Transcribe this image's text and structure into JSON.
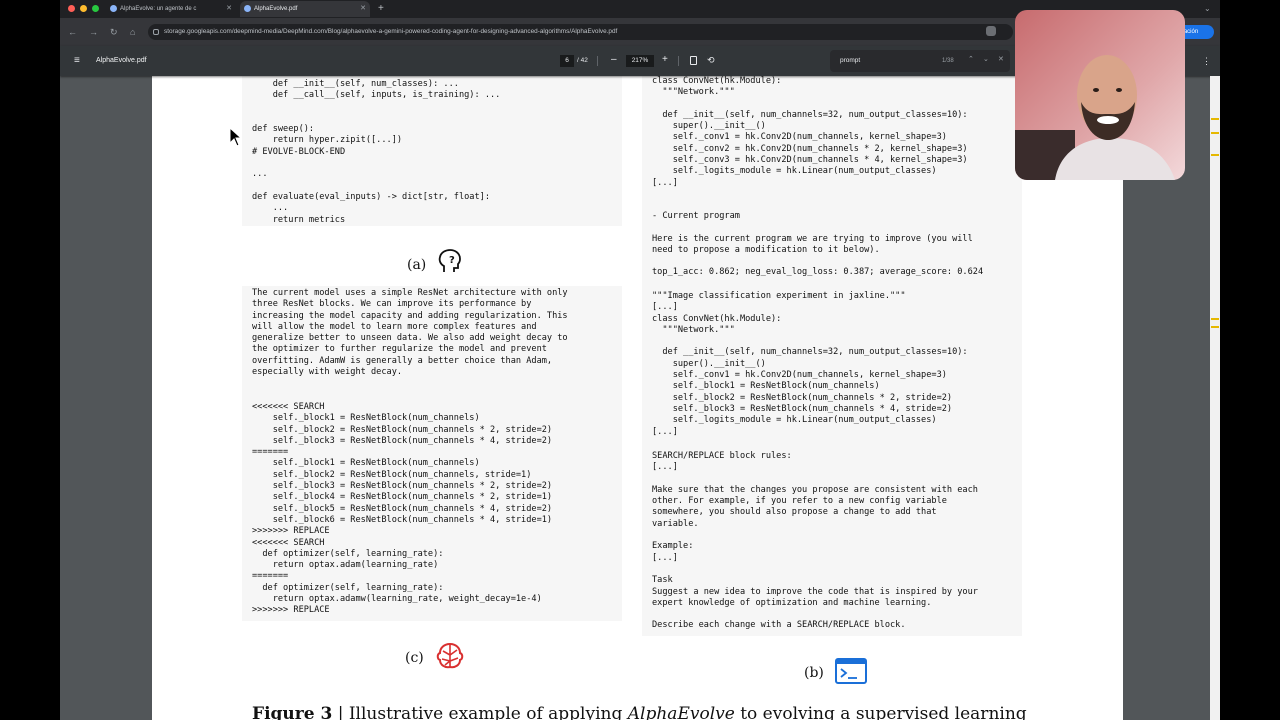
{
  "browser": {
    "tabs": [
      {
        "title": "AlphaEvolve: un agente de c"
      },
      {
        "title": "AlphaEvolve.pdf"
      }
    ],
    "url": "storage.googleapis.com/deepmind-media/DeepMind.com/Blog/alphaevolve-a-gemini-powered-coding-agent-for-designing-advanced-algorithms/AlphaEvolve.pdf",
    "update_button": "ación"
  },
  "pdf_toolbar": {
    "filename": "AlphaEvolve.pdf",
    "page_current": "6",
    "page_total": "/ 42",
    "zoom": "217%",
    "find_query": "prompt",
    "find_count": "1/38"
  },
  "document": {
    "left_top_code": "    def __init__(self, num_classes): ...\n    def __call__(self, inputs, is_training): ...\n\n\ndef sweep():\n    return hyper.zipit([...])\n# EVOLVE-BLOCK-END\n\n...\n\ndef evaluate(eval_inputs) -> dict[str, float]:\n    ...\n    return metrics",
    "label_a": "(a)",
    "prose_c": "The current model uses a simple ResNet architecture with only\nthree ResNet blocks. We can improve its performance by\nincreasing the model capacity and adding regularization. This\nwill allow the model to learn more complex features and\ngeneralize better to unseen data. We also add weight decay to\nthe optimizer to further regularize the model and prevent\noverfitting. AdamW is generally a better choice than Adam,\nespecially with weight decay.",
    "diff_c": "<<<<<<< SEARCH\n    self._block1 = ResNetBlock(num_channels)\n    self._block2 = ResNetBlock(num_channels * 2, stride=2)\n    self._block3 = ResNetBlock(num_channels * 4, stride=2)\n=======\n    self._block1 = ResNetBlock(num_channels)\n    self._block2 = ResNetBlock(num_channels, stride=1)\n    self._block3 = ResNetBlock(num_channels * 2, stride=2)\n    self._block4 = ResNetBlock(num_channels * 2, stride=1)\n    self._block5 = ResNetBlock(num_channels * 4, stride=2)\n    self._block6 = ResNetBlock(num_channels * 4, stride=1)\n>>>>>>> REPLACE\n<<<<<<< SEARCH\n  def optimizer(self, learning_rate):\n    return optax.adam(learning_rate)\n=======\n  def optimizer(self, learning_rate):\n    return optax.adamw(learning_rate, weight_decay=1e-4)\n>>>>>>> REPLACE",
    "label_c": "(c)",
    "right_top_code": "class ConvNet(hk.Module):\n  \"\"\"Network.\"\"\"\n\n  def __init__(self, num_channels=32, num_output_classes=10):\n    super().__init__()\n    self._conv1 = hk.Conv2D(num_channels, kernel_shape=3)\n    self._conv2 = hk.Conv2D(num_channels * 2, kernel_shape=3)\n    self._conv3 = hk.Conv2D(num_channels * 4, kernel_shape=3)\n    self._logits_module = hk.Linear(num_output_classes)\n[...]",
    "right_prompt_1": "- Current program\n\nHere is the current program we are trying to improve (you will\nneed to propose a modification to it below).\n\ntop_1_acc: 0.862; neg_eval_log_loss: 0.387; average_score: 0.624",
    "right_mid_code": "\"\"\"Image classification experiment in jaxline.\"\"\"\n[...]\nclass ConvNet(hk.Module):\n  \"\"\"Network.\"\"\"\n\n  def __init__(self, num_channels=32, num_output_classes=10):\n    super().__init__()\n    self._conv1 = hk.Conv2D(num_channels, kernel_shape=3)\n    self._block1 = ResNetBlock(num_channels)\n    self._block2 = ResNetBlock(num_channels * 2, stride=2)\n    self._block3 = ResNetBlock(num_channels * 4, stride=2)\n    self._logits_module = hk.Linear(num_output_classes)\n[...]",
    "right_prompt_2": "SEARCH/REPLACE block rules:\n[...]\n\nMake sure that the changes you propose are consistent with each\nother. For example, if you refer to a new config variable\nsomewhere, you should also propose a change to add that\nvariable.\n\nExample:\n[...]\n\nTask\nSuggest a new idea to improve the code that is inspired by your\nexpert knowledge of optimization and machine learning.\n\nDescribe each change with a SEARCH/REPLACE block.",
    "label_b": "(b)",
    "caption_prefix": "Figure 3",
    "caption_text": "| Illustrative example of applying",
    "caption_em": "AlphaEvolve",
    "caption_rest": "to evolving a supervised learning"
  },
  "colors": {
    "code_keyword": "#2a7a2a",
    "code_function": "#2020aa",
    "code_comment": "#c0392b",
    "icon_red": "#d93030",
    "icon_blue": "#1a6fd8"
  }
}
